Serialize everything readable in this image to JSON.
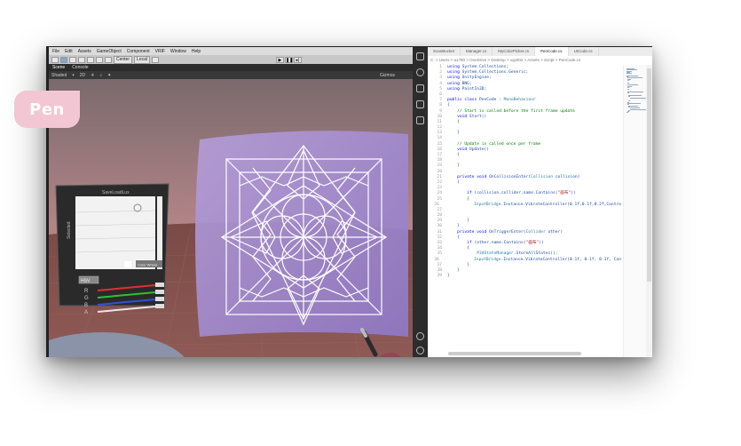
{
  "badge": {
    "label": "Pen"
  },
  "unity": {
    "menu": [
      "File",
      "Edit",
      "Assets",
      "GameObject",
      "Component",
      "VRIF",
      "Window",
      "Help"
    ],
    "toolbar": {
      "center": "Center",
      "local": "Local"
    },
    "tabs": [
      "Scene",
      "Console"
    ],
    "scene_toolbar": {
      "shading": "Shaded",
      "mode": "2D",
      "gizmos": "Gizmos"
    },
    "panel": {
      "title": "SaveLoadLux",
      "side_label": "Selected",
      "hsv_button": "HSV",
      "mode_button": "Color Wheel",
      "channels": [
        "R",
        "G",
        "B",
        "A"
      ],
      "channel_colors": [
        "#e03030",
        "#30c030",
        "#3050e0",
        "#e8e8e8"
      ]
    }
  },
  "vscode": {
    "tabs": [
      "ScanBucket",
      "Manager.cs",
      "MyColorPicker.cs",
      "PenCode.cs",
      "UICode.cs"
    ],
    "active_tab": "PenCode.cs",
    "breadcrumb": "C: > Users > a1780 > OneDrive > Desktop > xyp002 > Assets > Script > PenCode.cs",
    "lines": [
      "using System.Collections;",
      "using System.Collections.Generic;",
      "using UnityEngine;",
      "using BNG;",
      "using PaintIn3D;",
      "",
      "public class PenCode : MonoBehaviour",
      "{",
      "    // Start is called before the first frame update",
      "    void Start()",
      "    {",
      "",
      "    }",
      "",
      "    // Update is called once per frame",
      "    void Update()",
      "    {",
      "",
      "    }",
      "",
      "    private void OnCollisionEnter(Collision collision)",
      "    {",
      "",
      "        if (collision.collider.name.Contains(\"画布\"))",
      "        {",
      "            InputBridge.Instance.VibrateController(0.1f,0.1f,0.2f,Contro",
      "",
      "",
      "        }",
      "    }",
      "    private void OnTriggerEnter(Collider other)",
      "    {",
      "        if (other.name.Contains(\"画布\"))",
      "        {",
      "            P3dStateManager.StoreAllStates();",
      "            InputBridge.Instance.VibrateController(0.1f, 0.1f, 0.1f, Con",
      "        }",
      "    }",
      "}"
    ],
    "colors": {
      "keyword": "#0000ff",
      "comment": "#008000",
      "type": "#267f99",
      "string": "#a31515"
    }
  }
}
